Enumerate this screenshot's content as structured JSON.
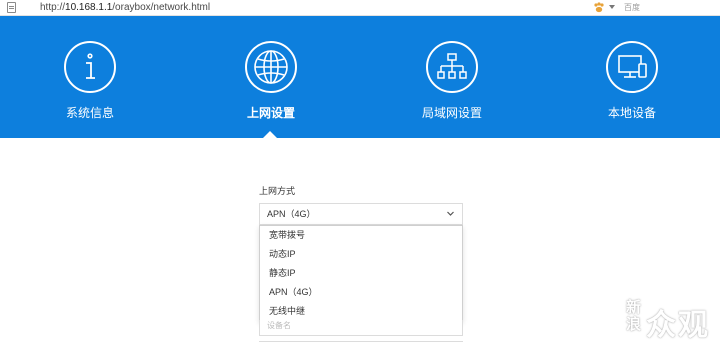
{
  "browser": {
    "url_prefix": "http://",
    "url_host": "10.168.1.1",
    "url_path": "/oraybox/network.html",
    "search_engine_label": "百度"
  },
  "nav": {
    "items": [
      {
        "label": "系统信息",
        "icon": "info-icon",
        "active": false
      },
      {
        "label": "上网设置",
        "icon": "globe-icon",
        "active": true
      },
      {
        "label": "局域网设置",
        "icon": "network-icon",
        "active": false
      },
      {
        "label": "本地设备",
        "icon": "devices-icon",
        "active": false
      }
    ]
  },
  "form": {
    "connection_label": "上网方式",
    "selected_value": "APN（4G）",
    "options": [
      "宽带拨号",
      "动态IP",
      "静态IP",
      "APN（4G）",
      "无线中继"
    ],
    "behind_placeholder": "设备名"
  },
  "watermark": {
    "text_1": "新",
    "text_2": "浪",
    "text_3": "众观"
  },
  "colors": {
    "header_blue": "#0d7fdd",
    "text_dark": "#333333",
    "border": "#dcdcdc"
  }
}
